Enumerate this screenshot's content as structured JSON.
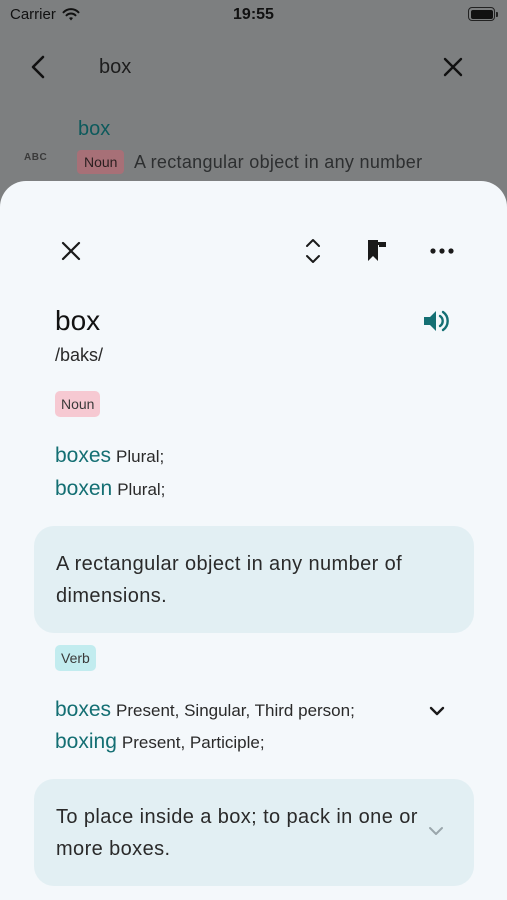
{
  "status_bar": {
    "carrier": "Carrier",
    "time": "19:55"
  },
  "search": {
    "query": "box",
    "result": {
      "icon_text": "ABC",
      "word": "box",
      "pos": "Noun",
      "definition": "A rectangular object in any number"
    }
  },
  "entry": {
    "headword": "box",
    "phonetic": "/baks/",
    "senses": [
      {
        "pos": "Noun",
        "forms": [
          {
            "word": "boxes",
            "label": "Plural;"
          },
          {
            "word": "boxen",
            "label": "Plural;"
          }
        ],
        "definition": "A rectangular object in any number of dimensions."
      },
      {
        "pos": "Verb",
        "forms": [
          {
            "word": "boxes",
            "label": "Present, Singular, Third person;"
          },
          {
            "word": "boxing",
            "label": "Present, Participle;"
          }
        ],
        "definition": "To place inside a box; to pack in one or more boxes."
      }
    ]
  },
  "colors": {
    "accent": "#146f73",
    "noun_chip": "#f6c9d2",
    "verb_chip": "#c2ecef",
    "card_bg": "#e2eff3",
    "sheet_bg": "#f4f8fb"
  },
  "icons": [
    "wifi-icon",
    "battery-icon",
    "back-arrow-icon",
    "clear-icon",
    "abc-icon",
    "close-icon",
    "expand-collapse-icon",
    "bookmark-icon",
    "more-icon",
    "speaker-icon",
    "chevron-down-icon"
  ]
}
